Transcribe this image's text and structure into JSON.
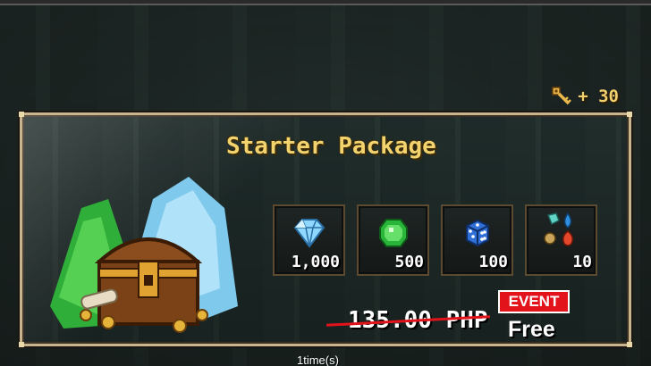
{
  "reward": {
    "icon": "key-icon",
    "text": "+ 30"
  },
  "package": {
    "title": "Starter Package",
    "items": [
      {
        "icon": "diamond-icon",
        "quantity": "1,000"
      },
      {
        "icon": "emerald-icon",
        "quantity": "500"
      },
      {
        "icon": "dice-icon",
        "quantity": "100"
      },
      {
        "icon": "elemental-gems-icon",
        "quantity": "10"
      }
    ],
    "badge": "EVENT",
    "original_price": "135.00 PHP",
    "price": "Free",
    "purchase_limit": "1time(s)"
  },
  "colors": {
    "title": "#f3d36e",
    "badge_bg": "#e3131c",
    "panel_border": "#c8b58d"
  }
}
